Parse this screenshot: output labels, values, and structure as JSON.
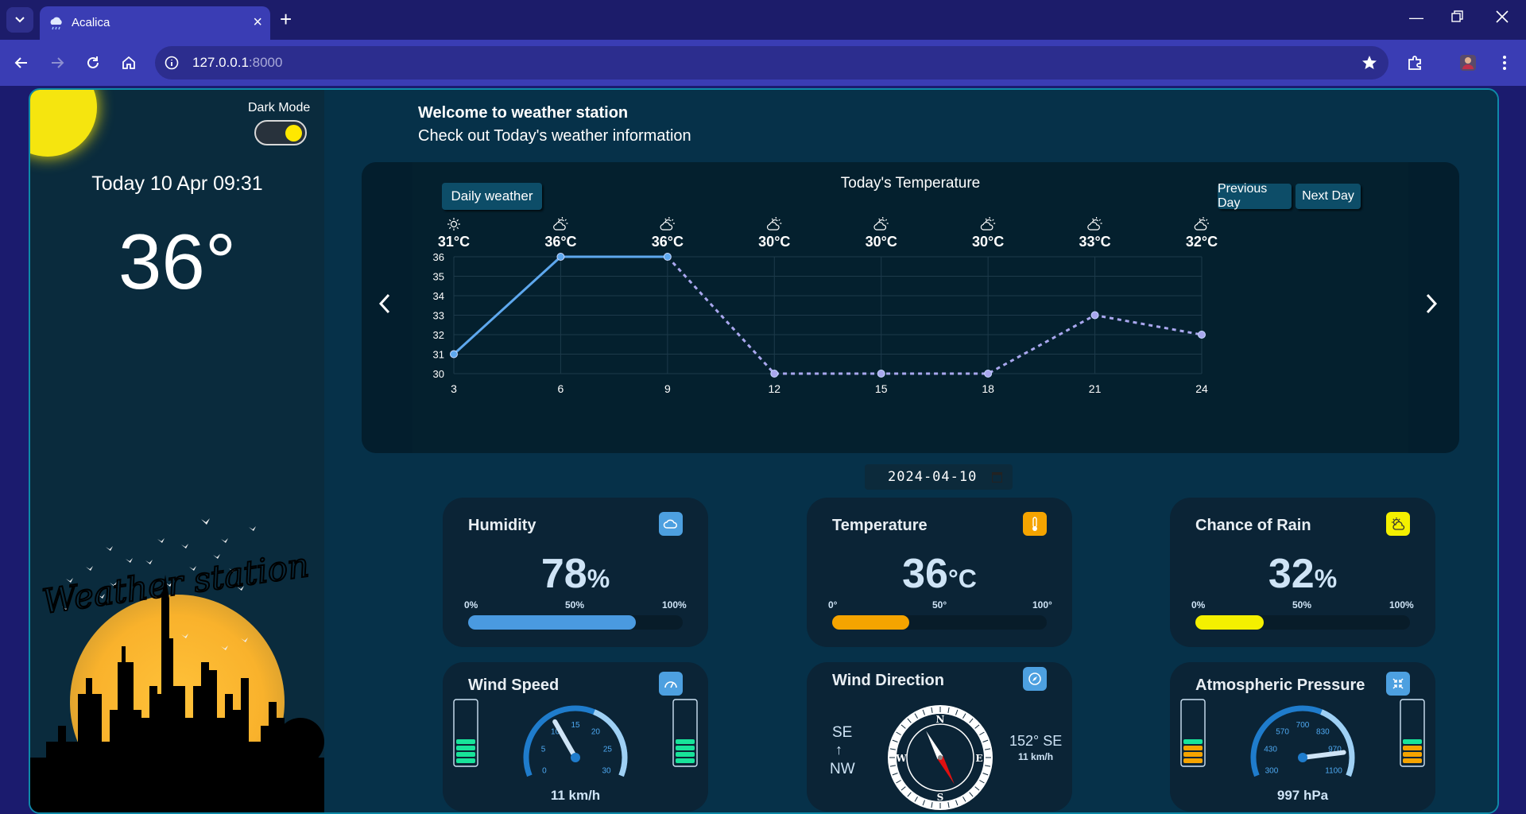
{
  "browser": {
    "tab_title": "Acalica",
    "url_host": "127.0.0.1",
    "url_port": ":8000"
  },
  "sidebar": {
    "dark_mode_label": "Dark Mode",
    "dark_mode_on": true,
    "today_label": "Today 10 Apr 09:31",
    "current_temp": "36°",
    "logo_text": "Weather station"
  },
  "header": {
    "welcome": "Welcome to weather station",
    "subtitle": "Check out Today's weather information"
  },
  "forecast": {
    "title": "Today's Temperature",
    "daily_button": "Daily weather",
    "prev_button": "Previous Day",
    "next_button": "Next Day",
    "date_value": "2024-04-10"
  },
  "chart_data": {
    "type": "line",
    "title": "Today's Temperature",
    "x": [
      3,
      6,
      9,
      12,
      15,
      18,
      21,
      24
    ],
    "y": [
      31,
      36,
      36,
      30,
      30,
      30,
      33,
      32
    ],
    "labels": [
      "31°C",
      "36°C",
      "36°C",
      "30°C",
      "30°C",
      "30°C",
      "33°C",
      "32°C"
    ],
    "icons": [
      "sun-icon",
      "partly-cloudy-icon",
      "partly-cloudy-icon",
      "partly-cloudy-icon",
      "partly-cloudy-icon",
      "partly-cloudy-icon",
      "partly-cloudy-icon",
      "partly-cloudy-icon"
    ],
    "ylim": [
      30,
      36
    ],
    "yticks": [
      30,
      31,
      32,
      33,
      34,
      35,
      36
    ],
    "solid_until_index": 2,
    "grid": true,
    "colors": {
      "observed": "#5ea8ee",
      "forecast": "#a9a7ee"
    }
  },
  "cards": {
    "humidity": {
      "title": "Humidity",
      "value": "78",
      "unit": "%",
      "scale": [
        "0%",
        "50%",
        "100%"
      ],
      "fraction": 0.78,
      "color": "#4a9ae0"
    },
    "temperature": {
      "title": "Temperature",
      "value": "36",
      "unit": "°C",
      "scale": [
        "0°",
        "50°",
        "100°"
      ],
      "fraction": 0.36,
      "color": "#f5a400"
    },
    "rain": {
      "title": "Chance of Rain",
      "value": "32",
      "unit": "%",
      "scale": [
        "0%",
        "50%",
        "100%"
      ],
      "fraction": 0.32,
      "color": "#f4f000"
    }
  },
  "wind_speed": {
    "title": "Wind Speed",
    "ticks": [
      "0",
      "5",
      "10",
      "15",
      "20",
      "25",
      "30"
    ],
    "reading": "11 km/h",
    "value": 11,
    "max": 30
  },
  "wind_direction": {
    "title": "Wind Direction",
    "from_label": "SE",
    "to_label": "NW",
    "degrees_label": "152° SE",
    "speed_label": "11 km/h",
    "heading_degrees": 152,
    "compass_letters": [
      "N",
      "E",
      "S",
      "W"
    ]
  },
  "pressure": {
    "title": "Atmospheric Pressure",
    "ticks": [
      "300",
      "430",
      "570",
      "700",
      "830",
      "970",
      "1100"
    ],
    "reading": "997 hPa",
    "value": 997,
    "min": 300,
    "max": 1100
  }
}
